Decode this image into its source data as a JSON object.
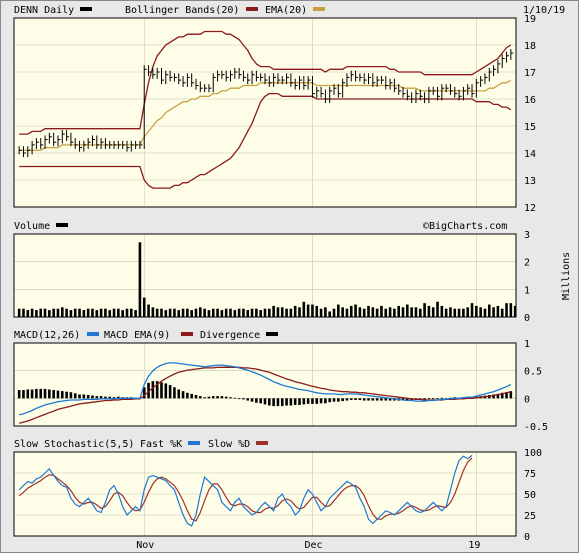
{
  "header": {
    "symbol_label": "DENN Daily",
    "bb_label": "Bollinger Bands(20)",
    "ema_label": "EMA(20)",
    "date_label": "1/10/19",
    "watermark": "©BigCharts.com"
  },
  "panels": {
    "volume": {
      "label": "Volume",
      "unit_label": "Millions"
    },
    "macd": {
      "label": "MACD(12,26)",
      "ema_label": "MACD EMA(9)",
      "div_label": "Divergence"
    },
    "stoch": {
      "label": "Slow Stochastic(5,5)",
      "fast_label": "Fast %K",
      "slow_label": "Slow %D"
    }
  },
  "colors": {
    "price": "#000000",
    "bollinger": "#8b1a1a",
    "ema": "#c8a040",
    "volume": "#000000",
    "macd": "#1e78d0",
    "macd_signal": "#8b1a1a",
    "divergence": "#000000",
    "fast_k": "#1e78d0",
    "slow_d": "#a0302a",
    "plot_bg": "#fefee8"
  },
  "chart_data": [
    {
      "type": "line",
      "title": "DENN Daily",
      "ylim": [
        12,
        19
      ],
      "yticks": [
        12,
        13,
        14,
        15,
        16,
        17,
        18,
        19
      ],
      "xticks": [
        "Nov",
        "Dec",
        "19"
      ],
      "xtick_index": [
        29,
        68,
        106
      ],
      "close": [
        14.1,
        14.0,
        14.1,
        14.3,
        14.4,
        14.3,
        14.5,
        14.6,
        14.4,
        14.5,
        14.7,
        14.6,
        14.4,
        14.3,
        14.2,
        14.3,
        14.4,
        14.5,
        14.3,
        14.4,
        14.3,
        14.3,
        14.3,
        14.3,
        14.3,
        14.2,
        14.3,
        14.3,
        14.3,
        17.1,
        17.0,
        16.9,
        17.0,
        16.7,
        16.9,
        16.8,
        16.8,
        16.7,
        16.6,
        16.8,
        16.6,
        16.5,
        16.4,
        16.4,
        16.4,
        16.8,
        16.9,
        16.9,
        16.8,
        16.9,
        17.0,
        16.9,
        16.8,
        16.7,
        16.9,
        16.8,
        16.8,
        16.7,
        16.6,
        16.8,
        16.7,
        16.7,
        16.8,
        16.6,
        16.5,
        16.7,
        16.5,
        16.7,
        16.2,
        16.3,
        16.2,
        16.0,
        16.3,
        16.4,
        16.2,
        16.6,
        16.8,
        16.9,
        16.8,
        16.8,
        16.7,
        16.8,
        16.6,
        16.7,
        16.7,
        16.5,
        16.6,
        16.4,
        16.3,
        16.2,
        16.1,
        16.0,
        16.2,
        16.1,
        16.0,
        16.3,
        16.3,
        16.1,
        16.4,
        16.4,
        16.3,
        16.2,
        16.1,
        16.3,
        16.4,
        16.2,
        16.6,
        16.7,
        16.8,
        17.0,
        17.1,
        17.3,
        17.5,
        17.6,
        17.7
      ],
      "bollinger_upper": [
        14.7,
        14.7,
        14.7,
        14.8,
        14.8,
        14.8,
        14.9,
        14.9,
        14.9,
        14.9,
        14.9,
        14.9,
        14.9,
        14.9,
        14.9,
        14.9,
        14.9,
        14.9,
        14.9,
        14.9,
        14.9,
        14.9,
        14.9,
        14.9,
        14.9,
        14.9,
        14.9,
        14.9,
        14.9,
        15.8,
        16.6,
        17.2,
        17.6,
        17.8,
        18.0,
        18.1,
        18.2,
        18.3,
        18.3,
        18.4,
        18.4,
        18.4,
        18.4,
        18.5,
        18.5,
        18.5,
        18.5,
        18.5,
        18.4,
        18.4,
        18.3,
        18.2,
        18.0,
        17.8,
        17.5,
        17.3,
        17.2,
        17.2,
        17.2,
        17.1,
        17.1,
        17.1,
        17.1,
        17.1,
        17.1,
        17.1,
        17.1,
        17.1,
        17.1,
        17.1,
        17.1,
        17.0,
        17.1,
        17.1,
        17.1,
        17.1,
        17.2,
        17.2,
        17.2,
        17.2,
        17.2,
        17.2,
        17.2,
        17.2,
        17.2,
        17.2,
        17.1,
        17.1,
        17.0,
        17.0,
        17.0,
        17.0,
        17.0,
        17.0,
        16.9,
        16.9,
        16.9,
        16.9,
        16.9,
        16.9,
        16.9,
        16.9,
        16.9,
        16.9,
        16.9,
        16.9,
        17.0,
        17.1,
        17.2,
        17.3,
        17.4,
        17.5,
        17.7,
        17.9,
        18.0
      ],
      "bollinger_lower": [
        13.5,
        13.5,
        13.5,
        13.5,
        13.5,
        13.5,
        13.5,
        13.5,
        13.5,
        13.5,
        13.5,
        13.5,
        13.5,
        13.5,
        13.5,
        13.5,
        13.5,
        13.5,
        13.5,
        13.5,
        13.5,
        13.5,
        13.5,
        13.5,
        13.5,
        13.5,
        13.5,
        13.5,
        13.5,
        13.0,
        12.8,
        12.7,
        12.7,
        12.7,
        12.7,
        12.7,
        12.8,
        12.8,
        12.9,
        12.9,
        13.0,
        13.1,
        13.2,
        13.2,
        13.3,
        13.4,
        13.5,
        13.6,
        13.7,
        13.8,
        14.0,
        14.2,
        14.5,
        14.8,
        15.1,
        15.5,
        15.9,
        16.1,
        16.2,
        16.2,
        16.2,
        16.1,
        16.1,
        16.1,
        16.1,
        16.1,
        16.1,
        16.1,
        16.1,
        16.0,
        16.0,
        16.0,
        16.0,
        16.0,
        16.0,
        16.0,
        16.0,
        16.0,
        16.0,
        16.0,
        16.0,
        16.0,
        16.0,
        16.0,
        16.0,
        16.0,
        16.0,
        16.0,
        16.0,
        16.0,
        16.0,
        16.0,
        16.0,
        16.0,
        16.0,
        16.0,
        16.0,
        16.0,
        16.0,
        16.0,
        16.0,
        16.0,
        16.0,
        16.0,
        16.0,
        16.0,
        15.9,
        15.9,
        15.9,
        15.9,
        15.8,
        15.8,
        15.7,
        15.7,
        15.6
      ],
      "ema20": [
        14.1,
        14.1,
        14.1,
        14.1,
        14.1,
        14.1,
        14.2,
        14.2,
        14.2,
        14.2,
        14.3,
        14.3,
        14.3,
        14.3,
        14.3,
        14.3,
        14.3,
        14.3,
        14.3,
        14.3,
        14.3,
        14.3,
        14.3,
        14.3,
        14.3,
        14.3,
        14.3,
        14.3,
        14.3,
        14.6,
        14.8,
        15.0,
        15.2,
        15.3,
        15.5,
        15.6,
        15.7,
        15.8,
        15.9,
        15.9,
        16.0,
        16.0,
        16.1,
        16.1,
        16.1,
        16.2,
        16.2,
        16.3,
        16.3,
        16.4,
        16.4,
        16.4,
        16.5,
        16.5,
        16.5,
        16.5,
        16.6,
        16.6,
        16.6,
        16.6,
        16.6,
        16.6,
        16.6,
        16.6,
        16.6,
        16.6,
        16.6,
        16.6,
        16.6,
        16.5,
        16.5,
        16.5,
        16.5,
        16.5,
        16.5,
        16.5,
        16.5,
        16.5,
        16.5,
        16.5,
        16.5,
        16.5,
        16.5,
        16.5,
        16.5,
        16.5,
        16.5,
        16.5,
        16.5,
        16.4,
        16.4,
        16.4,
        16.4,
        16.3,
        16.3,
        16.3,
        16.3,
        16.3,
        16.3,
        16.3,
        16.3,
        16.3,
        16.3,
        16.3,
        16.3,
        16.3,
        16.3,
        16.3,
        16.3,
        16.4,
        16.4,
        16.5,
        16.6,
        16.6,
        16.7
      ]
    },
    {
      "type": "bar",
      "title": "Volume",
      "ylabel": "Millions",
      "ylim": [
        0,
        3
      ],
      "yticks": [
        0,
        1,
        2,
        3
      ],
      "values": [
        0.3,
        0.3,
        0.25,
        0.3,
        0.25,
        0.3,
        0.3,
        0.25,
        0.3,
        0.3,
        0.35,
        0.3,
        0.25,
        0.3,
        0.3,
        0.25,
        0.3,
        0.3,
        0.25,
        0.3,
        0.3,
        0.25,
        0.3,
        0.3,
        0.25,
        0.3,
        0.3,
        0.25,
        2.7,
        0.7,
        0.45,
        0.35,
        0.3,
        0.3,
        0.25,
        0.3,
        0.3,
        0.25,
        0.3,
        0.3,
        0.25,
        0.3,
        0.35,
        0.3,
        0.25,
        0.3,
        0.3,
        0.25,
        0.3,
        0.3,
        0.25,
        0.3,
        0.3,
        0.25,
        0.3,
        0.3,
        0.25,
        0.3,
        0.3,
        0.4,
        0.35,
        0.35,
        0.3,
        0.3,
        0.4,
        0.35,
        0.55,
        0.45,
        0.45,
        0.4,
        0.3,
        0.35,
        0.2,
        0.3,
        0.45,
        0.35,
        0.3,
        0.4,
        0.45,
        0.35,
        0.3,
        0.4,
        0.35,
        0.3,
        0.4,
        0.3,
        0.35,
        0.3,
        0.4,
        0.35,
        0.45,
        0.35,
        0.35,
        0.3,
        0.5,
        0.4,
        0.35,
        0.55,
        0.4,
        0.3,
        0.35,
        0.3,
        0.3,
        0.3,
        0.35,
        0.5,
        0.4,
        0.35,
        0.3,
        0.45,
        0.35,
        0.4,
        0.3,
        0.5,
        0.5,
        0.4
      ]
    },
    {
      "type": "line",
      "title": "MACD(12,26)",
      "ylim": [
        -0.5,
        1.0
      ],
      "yticks": [
        -0.5,
        0.0,
        0.5,
        1.0
      ],
      "macd": [
        -0.3,
        -0.28,
        -0.25,
        -0.22,
        -0.18,
        -0.15,
        -0.12,
        -0.1,
        -0.08,
        -0.06,
        -0.05,
        -0.04,
        -0.03,
        -0.03,
        -0.03,
        -0.02,
        -0.02,
        -0.02,
        -0.02,
        -0.01,
        -0.01,
        -0.01,
        -0.01,
        0.0,
        0.0,
        0.0,
        0.0,
        0.0,
        0.0,
        0.25,
        0.4,
        0.5,
        0.56,
        0.6,
        0.63,
        0.64,
        0.64,
        0.63,
        0.62,
        0.61,
        0.6,
        0.59,
        0.58,
        0.57,
        0.58,
        0.59,
        0.6,
        0.6,
        0.59,
        0.58,
        0.57,
        0.55,
        0.53,
        0.51,
        0.48,
        0.45,
        0.42,
        0.38,
        0.34,
        0.3,
        0.27,
        0.24,
        0.22,
        0.2,
        0.18,
        0.16,
        0.15,
        0.14,
        0.12,
        0.1,
        0.09,
        0.08,
        0.08,
        0.08,
        0.07,
        0.07,
        0.08,
        0.08,
        0.08,
        0.07,
        0.06,
        0.05,
        0.04,
        0.03,
        0.02,
        0.01,
        0.0,
        -0.01,
        -0.02,
        -0.03,
        -0.04,
        -0.04,
        -0.05,
        -0.05,
        -0.05,
        -0.04,
        -0.04,
        -0.03,
        -0.02,
        -0.02,
        -0.01,
        0.0,
        0.0,
        0.01,
        0.02,
        0.02,
        0.04,
        0.06,
        0.08,
        0.1,
        0.12,
        0.15,
        0.18,
        0.21,
        0.25
      ],
      "signal": [
        -0.45,
        -0.43,
        -0.41,
        -0.38,
        -0.35,
        -0.32,
        -0.29,
        -0.26,
        -0.23,
        -0.2,
        -0.18,
        -0.16,
        -0.14,
        -0.12,
        -0.1,
        -0.09,
        -0.08,
        -0.07,
        -0.06,
        -0.05,
        -0.04,
        -0.04,
        -0.03,
        -0.03,
        -0.02,
        -0.02,
        -0.02,
        -0.01,
        -0.01,
        0.05,
        0.12,
        0.19,
        0.25,
        0.31,
        0.36,
        0.4,
        0.44,
        0.47,
        0.49,
        0.51,
        0.52,
        0.53,
        0.54,
        0.55,
        0.55,
        0.55,
        0.56,
        0.56,
        0.56,
        0.56,
        0.56,
        0.56,
        0.55,
        0.55,
        0.54,
        0.53,
        0.51,
        0.49,
        0.47,
        0.44,
        0.41,
        0.38,
        0.35,
        0.33,
        0.3,
        0.28,
        0.26,
        0.24,
        0.22,
        0.2,
        0.18,
        0.17,
        0.15,
        0.14,
        0.13,
        0.12,
        0.12,
        0.11,
        0.11,
        0.1,
        0.1,
        0.09,
        0.08,
        0.07,
        0.06,
        0.05,
        0.04,
        0.03,
        0.02,
        0.01,
        0.0,
        -0.01,
        -0.02,
        -0.02,
        -0.03,
        -0.03,
        -0.03,
        -0.03,
        -0.03,
        -0.02,
        -0.02,
        -0.02,
        -0.01,
        -0.01,
        0.0,
        0.0,
        0.01,
        0.02,
        0.03,
        0.04,
        0.05,
        0.07,
        0.08,
        0.1,
        0.12
      ]
    },
    {
      "type": "line",
      "title": "Slow Stochastic(5,5)",
      "ylim": [
        0,
        100
      ],
      "yticks": [
        0,
        25,
        50,
        75,
        100
      ],
      "fast_k": [
        55,
        60,
        65,
        63,
        68,
        70,
        75,
        80,
        72,
        65,
        60,
        58,
        45,
        38,
        35,
        40,
        45,
        38,
        30,
        28,
        40,
        55,
        60,
        50,
        35,
        25,
        30,
        35,
        30,
        55,
        70,
        72,
        70,
        68,
        66,
        60,
        55,
        40,
        25,
        15,
        12,
        25,
        50,
        70,
        65,
        60,
        55,
        40,
        35,
        30,
        40,
        45,
        35,
        30,
        25,
        28,
        35,
        40,
        35,
        30,
        45,
        50,
        40,
        35,
        25,
        30,
        45,
        55,
        50,
        40,
        30,
        35,
        45,
        50,
        55,
        60,
        65,
        62,
        58,
        45,
        35,
        20,
        15,
        20,
        25,
        30,
        28,
        25,
        30,
        35,
        40,
        35,
        30,
        28,
        30,
        35,
        40,
        35,
        30,
        35,
        55,
        75,
        90,
        95,
        92,
        96
      ],
      "slow_d": [
        48,
        52,
        57,
        60,
        63,
        66,
        70,
        73,
        72,
        68,
        64,
        60,
        54,
        46,
        40,
        38,
        40,
        40,
        37,
        33,
        35,
        42,
        50,
        52,
        48,
        40,
        33,
        30,
        31,
        40,
        52,
        62,
        68,
        70,
        68,
        64,
        60,
        52,
        42,
        30,
        20,
        18,
        28,
        42,
        55,
        62,
        62,
        55,
        46,
        38,
        36,
        38,
        38,
        35,
        30,
        28,
        28,
        32,
        34,
        33,
        36,
        42,
        44,
        42,
        36,
        32,
        34,
        40,
        46,
        46,
        40,
        35,
        36,
        42,
        48,
        54,
        58,
        60,
        60,
        56,
        48,
        36,
        26,
        20,
        20,
        24,
        26,
        26,
        27,
        30,
        34,
        36,
        34,
        31,
        30,
        31,
        34,
        36,
        35,
        34,
        40,
        50,
        64,
        78,
        88,
        93
      ]
    }
  ]
}
